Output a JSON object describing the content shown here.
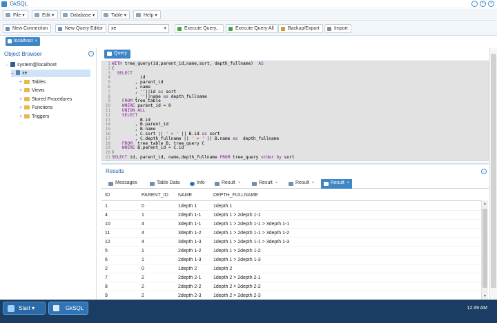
{
  "window": {
    "title": "GkSQL"
  },
  "menus": [
    "File",
    "Edit",
    "Database",
    "Table",
    "Help"
  ],
  "toolbar": {
    "new_connection": "New Connection",
    "new_query_editor": "New Query Editor",
    "connection_select": "xe",
    "execute_query": "Execute Query...",
    "execute_query_all": "Execute Query All",
    "backup_export": "Backup/Export",
    "import": "Import"
  },
  "connection_tab": {
    "label": "localhost"
  },
  "object_browser": {
    "title": "Object Browser",
    "server": "system@localhost",
    "database": "xe",
    "children": [
      "Tables",
      "Views",
      "Stored Procedures",
      "Functions",
      "Triggers"
    ]
  },
  "editor": {
    "tab_label": "Query",
    "line_numbers": [
      "1",
      "2",
      "3",
      "4",
      "5",
      "6",
      "7",
      "8",
      "9",
      "10",
      "11",
      "12",
      "13",
      "14",
      "15",
      "16",
      "17",
      "18",
      "19",
      "20",
      "21",
      "22"
    ],
    "lines": [
      "WITH tree_query(id,parent_id,name,sort, depth_fullname)  AS",
      "(",
      "  SELECT",
      "           id",
      "         , parent_id",
      "         , name",
      "         , ''||id as sort",
      "         , ''||name as depth_fullname",
      "    FROM tree_table",
      "    WHERE parent_id = 0",
      "    UNION ALL",
      "    SELECT",
      "           B.id",
      "         , B.parent_id",
      "         , B.name",
      "         , C.sort || ' > ' || B.id as sort",
      "         , C.depth_fullname || ' > ' || B.name as  depth_fullname",
      "    FROM  tree_table B, tree_query C",
      "    WHERE B.parent_id = C.id",
      ")",
      "SELECT id, parent_id, name,depth_fullname FROM tree_query order by sort",
      ""
    ]
  },
  "results": {
    "title": "Results",
    "tabs": [
      "Messages",
      "Table Data",
      "Info",
      "Result",
      "Result",
      "Result",
      "Result"
    ],
    "active_tab": "Result",
    "columns": [
      "ID",
      "PARENT_ID",
      "NAME",
      "DEPTH_FULLNAME"
    ],
    "rows": [
      [
        "1",
        "0",
        "1depth 1",
        "1depth 1"
      ],
      [
        "4",
        "1",
        "2depth 1-1",
        "1depth 1 > 2depth 1-1"
      ],
      [
        "10",
        "4",
        "3depth 1-1",
        "1depth 1 > 2depth 1-1 > 3depth 1-1"
      ],
      [
        "11",
        "4",
        "3depth 1-2",
        "1depth 1 > 2depth 1-1 > 3depth 1-2"
      ],
      [
        "12",
        "4",
        "3depth 1-3",
        "1depth 1 > 2depth 1-1 > 3depth 1-3"
      ],
      [
        "5",
        "1",
        "2depth 1-2",
        "1depth 1 > 2depth 1-2"
      ],
      [
        "6",
        "1",
        "2depth 1-3",
        "1depth 1 > 2depth 1-3"
      ],
      [
        "2",
        "0",
        "1depth 2",
        "1depth 2"
      ],
      [
        "7",
        "2",
        "2depth 2-1",
        "1depth 2 > 2depth 2-1"
      ],
      [
        "8",
        "2",
        "2depth 2-2",
        "1depth 2 > 2depth 2-2"
      ],
      [
        "9",
        "2",
        "2depth 2-3",
        "1depth 2 > 2depth 2-3"
      ]
    ]
  },
  "taskbar": {
    "start": "Start",
    "app": "GkSQL",
    "clock": "12:49 AM"
  },
  "colors": {
    "accent": "#3d86c7",
    "editor_bg": "#e2e2e2",
    "keyword": "#7a1f8f",
    "taskbar": "#1c3d63"
  }
}
